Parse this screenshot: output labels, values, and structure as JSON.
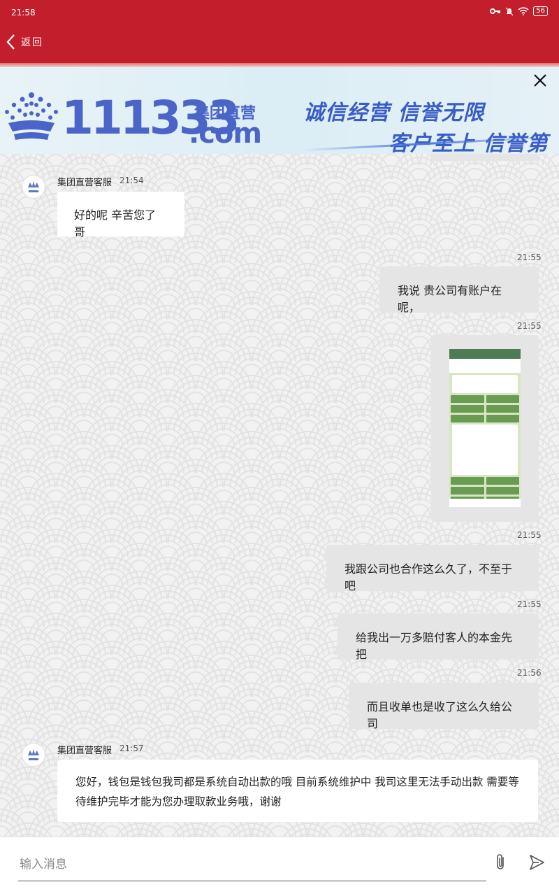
{
  "status_bar": {
    "time": "21:58",
    "battery": "56"
  },
  "nav": {
    "back_label": "返回"
  },
  "banner": {
    "brand_number": "111333",
    "brand_sub": "集团直营",
    "brand_domain": ".com",
    "slogan_line1": "诚信经营 信誉无限",
    "slogan_line2": "客户至上 信誉第一"
  },
  "messages": [
    {
      "from": "agent",
      "sender": "集团直营客服",
      "time": "21:54",
      "text": "好的呢 辛苦您了 哥"
    },
    {
      "from": "me",
      "time": "21:55",
      "text": "我说 贵公司有账户在呢，"
    },
    {
      "from": "me",
      "time": "21:55",
      "type": "image"
    },
    {
      "from": "me",
      "time": "21:55",
      "text": "我跟公司也合作这么久了，不至于吧"
    },
    {
      "from": "me",
      "time": "21:55",
      "text": "给我出一万多赔付客人的本金先把"
    },
    {
      "from": "me",
      "time": "21:56",
      "text": "而且收单也是收了这么久给公司"
    },
    {
      "from": "agent",
      "sender": "集团直营客服",
      "time": "21:57",
      "text": "您好，钱包是钱包我司都是系统自动出款的哦 目前系统维护中 我司这里无法手动出款 需要等待维护完毕才能为您办理取款业务哦，谢谢"
    }
  ],
  "input": {
    "placeholder": "输入消息"
  },
  "colors": {
    "header": "#c31e2c",
    "brand_blue": "#4a64c8",
    "my_bubble": "#e5e5e5",
    "agent_bubble": "#ffffff"
  },
  "icons": [
    "chevron-left-icon",
    "key-icon",
    "bell-off-icon",
    "wifi-icon",
    "battery-icon",
    "close-icon",
    "crown-logo",
    "paperclip-icon",
    "send-icon"
  ]
}
